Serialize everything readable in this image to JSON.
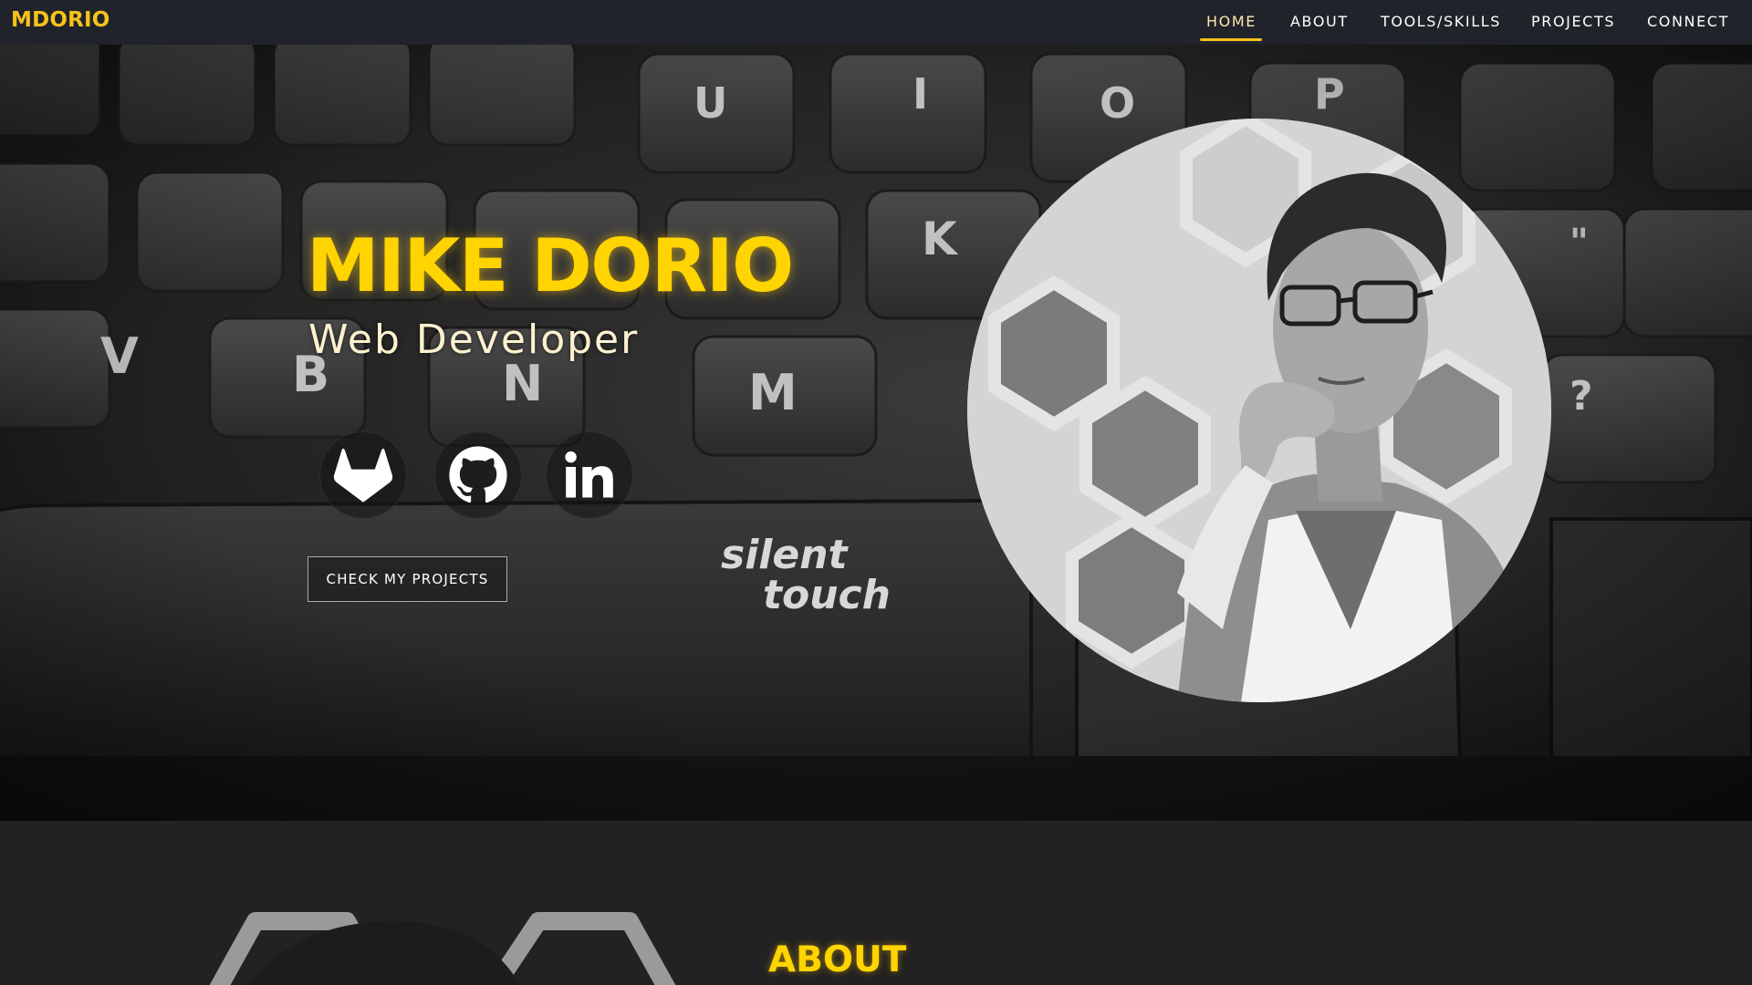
{
  "nav": {
    "brand": "MDORIO",
    "links": [
      {
        "label": "HOME",
        "active": true
      },
      {
        "label": "ABOUT",
        "active": false
      },
      {
        "label": "TOOLS/SKILLS",
        "active": false
      },
      {
        "label": "PROJECTS",
        "active": false
      },
      {
        "label": "CONNECT",
        "active": false
      }
    ]
  },
  "hero": {
    "name": "MIKE DORIO",
    "role": "Web Developer",
    "social": [
      {
        "icon": "gitlab-icon"
      },
      {
        "icon": "github-icon"
      },
      {
        "icon": "linkedin-icon"
      }
    ],
    "cta_label": "CHECK MY PROJECTS",
    "keyboard_brand": "silent touch"
  },
  "about": {
    "title": "ABOUT"
  },
  "colors": {
    "accent": "#ffd400",
    "nav_bg": "#20232a",
    "page_bg": "#222222"
  }
}
